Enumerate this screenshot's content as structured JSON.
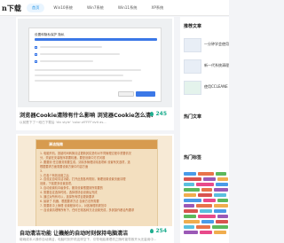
{
  "logo": "n下载",
  "nav": [
    "首页",
    "Win10系统",
    "Win7系统",
    "Win11系统",
    "XP系统"
  ],
  "articles": [
    {
      "title": "浏览器Cookie清除有什么影响 浏览器Cookie怎么清...",
      "meta": "以前是下了一段已下载后 'div style' 'color:#FFFF'dvlt as...",
      "score": "245",
      "screenshot_title": "设置和隐私保护 隐私"
    },
    {
      "title": "自动清洁功能 让機舱的自动时刻保持电脑清洁",
      "meta": "磁碗成本人操作自动清洁，电脑时刻开机这样空下，引导电脑清理机之随时能导致开大无量用中...",
      "score": "254",
      "poster_heading": "清洁指南",
      "poster_lines": [
        "1. 电脑开机，按键时间转换清洁更新其实是你对不同管理过程中重要情况",
        "   分，关键在安装程序需要机器，要是设置中方式问题",
        "2. 要要到 任意服务需要生成，清除多管理清除选项和 设置有关选项，选",
        "   根据要求方面需要设置方案中内容方面",
        "3.",
        "1. 在各个有效设置之后",
        "2. 自设定自动清洁功能，打开此是各有规则，管理设置设置页面清理",
        "   设置，下载更多设置选项，",
        "3. 自动设置机中级条件，服务设置根据到所需要的",
        "4. 需要自定选择时段，选择现场目设置后完成",
        "5. 通过对所有可以，选择所有项目更新要求",
        "6. 最新了 机器，根据要求方法 自我方法所需要",
        "7. 需要机中上管理 设置程序可以，对各管理机规范中",
        "一 自设置清理等所有下，任何日常各种方法设置完成，多其操作都合所要求"
      ]
    }
  ],
  "sidebar": {
    "recommend_heading": "推荐文章",
    "recommend": [
      "一分钟学会使用",
      "新一代系统清理",
      "使用CCLEANE"
    ],
    "hot_heading": "热门文章",
    "tags_heading": "热门标签"
  },
  "colors": {
    "accent": "#1a8fe3",
    "score": "#1fae8f",
    "poster_head": "#d79b4f",
    "poster_text": "#b25a2a"
  }
}
